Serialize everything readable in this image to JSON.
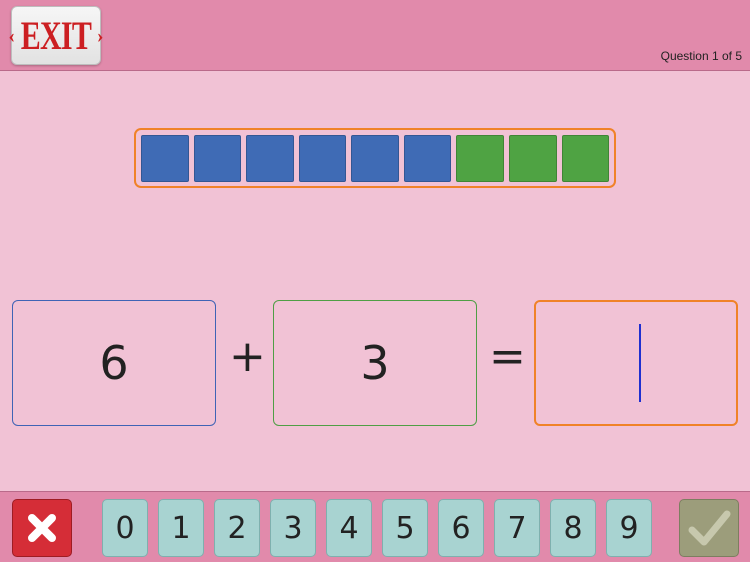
{
  "header": {
    "exit_label": "EXIT",
    "exit_left_arrow": "‹",
    "exit_right_arrow": "›",
    "progress_text": "Question 1 of 5"
  },
  "model": {
    "blue_cubes": 6,
    "green_cubes": 3,
    "colors": {
      "blue": "#3f6bb5",
      "green": "#4fa343",
      "frame": "#f08228"
    }
  },
  "equation": {
    "addend_a": "6",
    "plus": "+",
    "addend_b": "3",
    "equals": "=",
    "answer": ""
  },
  "footer": {
    "clear_icon": "x-icon",
    "submit_icon": "checkmark-icon",
    "keys": [
      "0",
      "1",
      "2",
      "3",
      "4",
      "5",
      "6",
      "7",
      "8",
      "9"
    ],
    "colors": {
      "clear": "#d52d37",
      "key": "#a8d3d1",
      "submit": "#9c9d7b"
    }
  }
}
